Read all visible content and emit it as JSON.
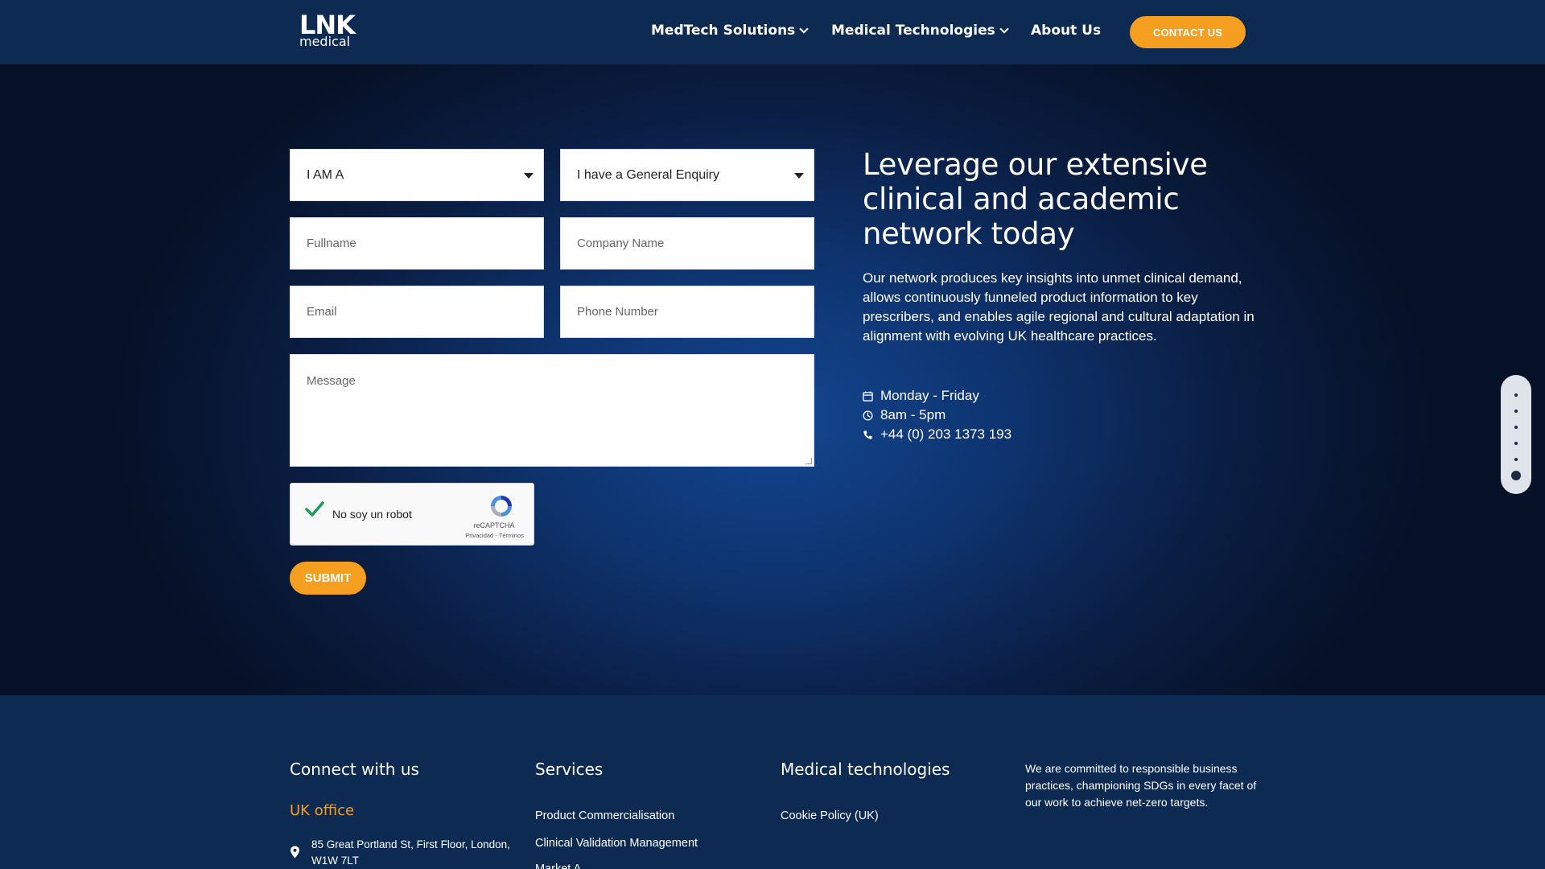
{
  "header": {
    "logo_top": "LNK",
    "logo_bottom": "medical",
    "nav": [
      {
        "label": "MedTech Solutions",
        "has_dropdown": true
      },
      {
        "label": "Medical Technologies",
        "has_dropdown": true
      },
      {
        "label": "About Us",
        "has_dropdown": false
      }
    ],
    "contact_label": "CONTACT US"
  },
  "form": {
    "role_select": "I AM A",
    "enquiry_select": "I have a General Enquiry",
    "fullname_placeholder": "Fullname",
    "company_placeholder": "Company Name",
    "email_placeholder": "Email",
    "phone_placeholder": "Phone Number",
    "message_placeholder": "Message",
    "captcha_label": "No soy un robot",
    "captcha_brand": "reCAPTCHA",
    "captcha_links": "Privacidad - Términos",
    "submit_label": "SUBMIT"
  },
  "hero": {
    "title": "Leverage our extensive clinical and academic network today",
    "text": "Our network produces key insights into unmet clinical demand, allows continuously funneled product information to key prescribers, and enables agile regional and cultural adaptation in alignment with evolving UK healthcare practices.",
    "days": "Monday - Friday",
    "hours": "8am - 5pm",
    "phone": "+44 (0) 203 1373 193"
  },
  "footer": {
    "connect_heading": "Connect with us",
    "office_heading": "UK office",
    "address": "85 Great Portland St, First Floor, London, W1W 7LT",
    "services_heading": "Services",
    "services": [
      "Product Commercialisation",
      "Clinical Validation Management",
      "Market A"
    ],
    "medtech_heading": "Medical technologies",
    "medtech_links": [
      "Cookie Policy (UK)"
    ],
    "commitment": "We are committed to responsible business practices, championing SDGs in every facet of our work to achieve net-zero targets."
  },
  "colors": {
    "accent": "#f59e1f",
    "header_bg": "#0c2a52",
    "hero_glow": "#134690"
  },
  "scroll_indicator": {
    "sections": 6,
    "active_index": 5
  }
}
